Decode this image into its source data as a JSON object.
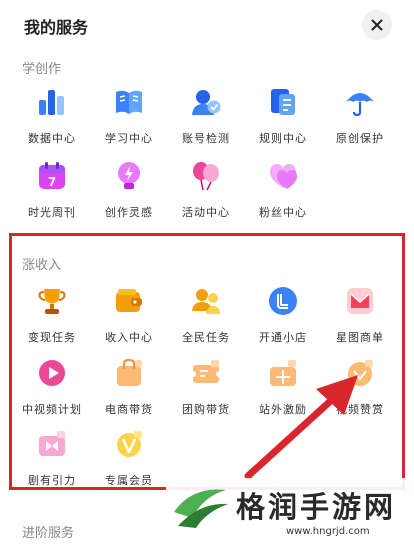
{
  "header": {
    "title": "我的服务"
  },
  "sections": {
    "learn": {
      "title": "学创作",
      "items": [
        {
          "label": "数据中心",
          "icon": "bar-chart-icon"
        },
        {
          "label": "学习中心",
          "icon": "book-icon"
        },
        {
          "label": "账号检测",
          "icon": "user-check-icon"
        },
        {
          "label": "规则中心",
          "icon": "document-icon"
        },
        {
          "label": "原创保护",
          "icon": "umbrella-icon"
        },
        {
          "label": "时光周刊",
          "icon": "calendar-icon"
        },
        {
          "label": "创作灵感",
          "icon": "lightbulb-icon"
        },
        {
          "label": "活动中心",
          "icon": "balloon-icon"
        },
        {
          "label": "粉丝中心",
          "icon": "heart-icon"
        }
      ]
    },
    "income": {
      "title": "涨收入",
      "items": [
        {
          "label": "变现任务",
          "icon": "trophy-icon"
        },
        {
          "label": "收入中心",
          "icon": "wallet-icon"
        },
        {
          "label": "全民任务",
          "icon": "people-icon"
        },
        {
          "label": "开通小店",
          "icon": "shop-icon"
        },
        {
          "label": "星图商单",
          "icon": "star-map-icon"
        },
        {
          "label": "中视频计划",
          "icon": "play-icon"
        },
        {
          "label": "电商带货",
          "icon": "shopping-bag-icon"
        },
        {
          "label": "团购带货",
          "icon": "coupon-icon"
        },
        {
          "label": "站外激励",
          "icon": "gift-box-icon"
        },
        {
          "label": "视频赞赏",
          "icon": "reward-icon"
        },
        {
          "label": "剧有引力",
          "icon": "film-icon"
        },
        {
          "label": "专属会员",
          "icon": "vip-icon"
        }
      ]
    },
    "advanced": {
      "title": "进阶服务"
    }
  },
  "watermark": {
    "name": "格润手游网",
    "url": "www.hngrjd.com"
  }
}
